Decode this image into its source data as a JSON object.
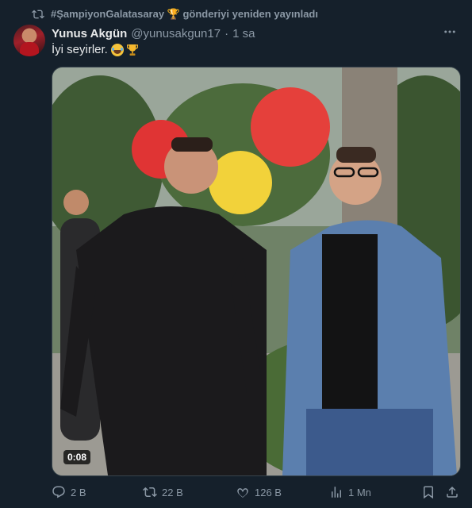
{
  "retweet": {
    "icon": "retweet-icon",
    "text": "#ŞampiyonGalatasaray 🏆 gönderiyi yeniden yayınladı"
  },
  "tweet": {
    "author": {
      "name": "Yunus Akgün",
      "handle": "@yunusakgun17",
      "separator": "·",
      "time": "1 sa"
    },
    "text": "İyi seyirler.",
    "text_emojis": [
      "face-with-tears-of-joy-emoji",
      "trophy-emoji"
    ],
    "media": {
      "type": "video",
      "duration": "0:08"
    }
  },
  "actions": {
    "replies": "2 B",
    "retweets": "22 B",
    "likes": "126 B",
    "views": "1 Mn"
  },
  "colors": {
    "background": "#15202b",
    "primary_text": "#e7e9ea",
    "secondary_text": "#8b98a5",
    "trophy": "#f5b82e"
  }
}
